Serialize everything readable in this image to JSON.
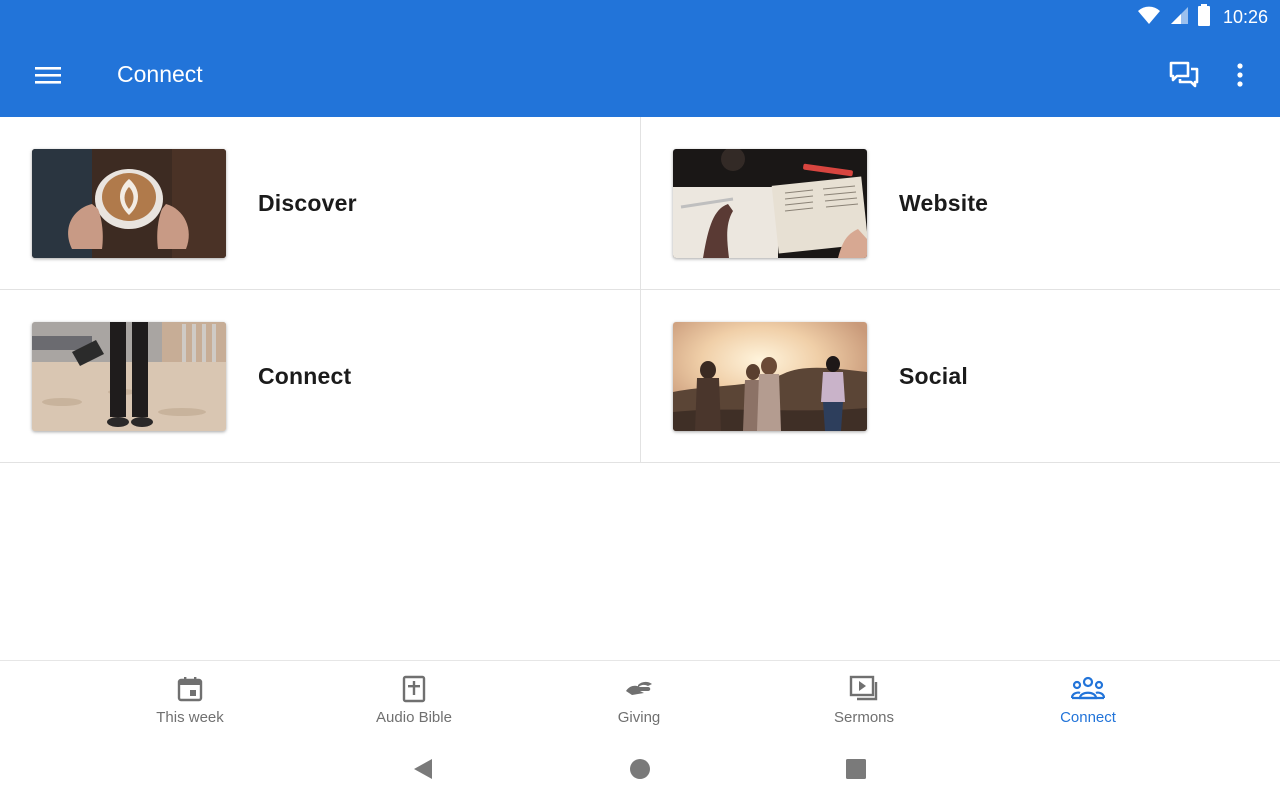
{
  "status_bar": {
    "time": "10:26",
    "icons": [
      "wifi-icon",
      "signal-icon",
      "battery-icon"
    ]
  },
  "app_bar": {
    "title": "Connect",
    "left_icon": "menu-icon",
    "right_icons": [
      "chat-icon",
      "more-vert-icon"
    ]
  },
  "tiles": [
    {
      "label": "Discover",
      "image": "coffee-latte-photo"
    },
    {
      "label": "Website",
      "image": "bible-notebook-photo"
    },
    {
      "label": "Connect",
      "image": "person-standing-sand-photo"
    },
    {
      "label": "Social",
      "image": "friends-sunset-photo"
    }
  ],
  "bottom_nav": {
    "items": [
      {
        "label": "This week",
        "icon": "calendar-icon",
        "active": false
      },
      {
        "label": "Audio Bible",
        "icon": "bible-icon",
        "active": false
      },
      {
        "label": "Giving",
        "icon": "giving-hand-icon",
        "active": false
      },
      {
        "label": "Sermons",
        "icon": "video-library-icon",
        "active": false
      },
      {
        "label": "Connect",
        "icon": "group-icon",
        "active": true
      }
    ]
  },
  "system_nav": [
    "back-icon",
    "home-icon",
    "recents-icon"
  ],
  "colors": {
    "primary": "#2274d9",
    "inactive": "#707070",
    "text": "#1b1b1b",
    "divider": "#e2e2e2"
  }
}
